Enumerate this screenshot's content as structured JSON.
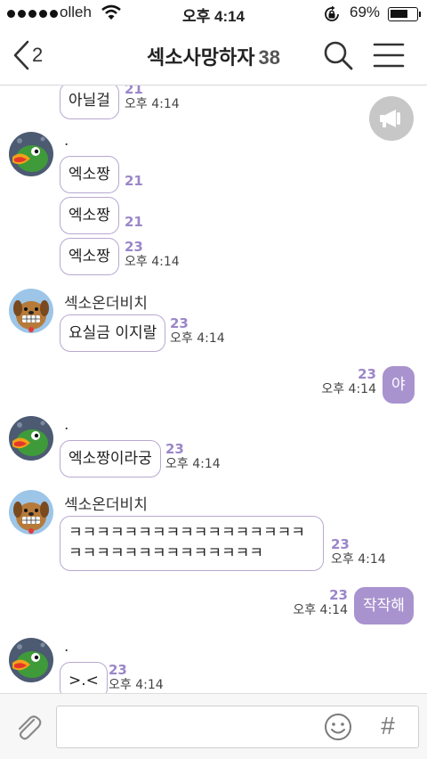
{
  "status_bar": {
    "carrier": "olleh",
    "time": "오후 4:14",
    "battery": "69%",
    "battery_level": 0.69,
    "icons": [
      "signal-dots-icon",
      "wifi-icon",
      "orientation-lock-icon",
      "battery-icon"
    ]
  },
  "header": {
    "back_count": "2",
    "title": "섹소사망하자",
    "member_count": "38",
    "icons": [
      "back-chevron-icon",
      "search-icon",
      "menu-icon"
    ]
  },
  "notice_icon": "megaphone-icon",
  "messages": [
    {
      "text": "아닐걸",
      "count": "21",
      "time": "오후 4:14"
    },
    {
      "sender": ".",
      "text": "엑소짱",
      "count": "21",
      "time": ""
    },
    {
      "text": "엑소짱",
      "count": "21",
      "time": ""
    },
    {
      "text": "엑소짱",
      "count": "23",
      "time": "오후 4:14"
    },
    {
      "sender": "섹소온더비치",
      "text": "요실금 이지랄",
      "count": "23",
      "time": "오후 4:14"
    },
    {
      "text": "야",
      "count": "23",
      "time": "오후 4:14",
      "mine": true
    },
    {
      "sender": ".",
      "text": "엑소짱이라궁",
      "count": "23",
      "time": "오후 4:14"
    },
    {
      "sender": "섹소온더비치",
      "text": "ㅋㅋㅋㅋㅋㅋㅋㅋㅋㅋㅋㅋㅋㅋㅋㅋㅋㅋㅋㅋㅋㅋㅋㅋㅋㅋㅋㅋㅋㅋㅋ",
      "count": "23",
      "time": "오후 4:14"
    },
    {
      "text": "작작해",
      "count": "23",
      "time": "오후 4:14",
      "mine": true
    },
    {
      "sender": ".",
      "text": ">.<",
      "count": "23",
      "time": "오후 4:14"
    }
  ],
  "input_bar": {
    "placeholder": "",
    "hash_label": "#",
    "icons": [
      "paperclip-icon",
      "emoji-icon"
    ]
  },
  "colors": {
    "accent": "#a993cf",
    "bubble_border": "#b7a8d0",
    "unread_count": "#9b86c9"
  }
}
